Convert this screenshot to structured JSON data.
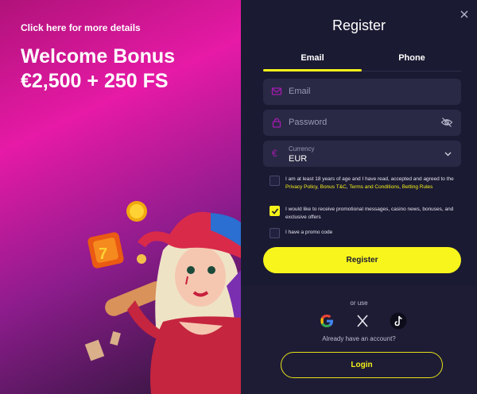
{
  "promo": {
    "link": "Click here for more details",
    "title_line1": "Welcome Bonus",
    "title_line2": "€2,500 + 250 FS"
  },
  "form": {
    "title": "Register",
    "tabs": [
      {
        "label": "Email",
        "active": true
      },
      {
        "label": "Phone",
        "active": false
      }
    ],
    "email_placeholder": "Email",
    "password_placeholder": "Password",
    "currency_label": "Currency",
    "currency_value": "EUR",
    "consents": [
      {
        "checked": false,
        "text_before": "I am at least 18 years of age and I have read, accepted and agreed to the ",
        "link1": "Privacy Policy",
        "sep1": ", ",
        "link2": "Bonus T&C",
        "sep2": ", ",
        "link3": "Terms and Conditions",
        "sep3": ", ",
        "link4": "Betting Rules"
      },
      {
        "checked": true,
        "text": "I would like to receive promotional messages, casino news, bonuses, and exclusive offers"
      },
      {
        "checked": false,
        "text": "I have a promo code"
      }
    ],
    "register_button": "Register",
    "or_use": "or use",
    "social": [
      "google-icon",
      "x-icon",
      "tiktok-icon"
    ],
    "already": "Already have an account?",
    "login_button": "Login"
  },
  "colors": {
    "accent": "#f4f11a",
    "panel": "#1b1a33",
    "field": "#2a2945",
    "icon_purple": "#a21caf"
  }
}
